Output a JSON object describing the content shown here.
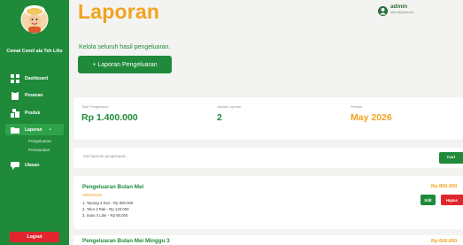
{
  "sidebar": {
    "brand": "Cemal Cemil ala Teh Lilis",
    "items": [
      {
        "label": "Dashboard",
        "icon": "grid-icon"
      },
      {
        "label": "Pesanan",
        "icon": "clipboard-icon"
      },
      {
        "label": "Produk",
        "icon": "products-icon"
      },
      {
        "label": "Laporan",
        "icon": "folder-icon",
        "active": true
      },
      {
        "label": "Ulasan",
        "icon": "chat-icon"
      }
    ],
    "sub_items": [
      "Pengeluaran",
      "Pemasukan"
    ],
    "active_marker": "•",
    "logout_label": "Logout"
  },
  "header": {
    "title": "Laporan",
    "subtitle": "Kelola seluruh hasil pengeluaran.",
    "add_button": "+ Laporan Pengeluaran"
  },
  "user": {
    "name": "admin",
    "email": "admin@gmail.com"
  },
  "stats": [
    {
      "label": "Total Pengeluaran",
      "value": "Rp 1.400.000"
    },
    {
      "label": "Jumlah Laporan",
      "value": "2"
    },
    {
      "label": "Periode",
      "value": "May 2026"
    }
  ],
  "search": {
    "placeholder": "Cari laporan pengeluaran",
    "button": "Cari"
  },
  "reports": [
    {
      "title": "Pengeluaran Bulan Mei",
      "date": "28/05/2026",
      "lines": [
        "1. Tepung 3 Dus - Rp 600.000",
        "2. Telur 3 Rak - Rp 120.000",
        "3. Susu 4 Liter - Rp 80.000"
      ],
      "amount": "Rp 800.000",
      "edit": "Edit",
      "delete": "Hapus"
    },
    {
      "title": "Pengeluaran Bulan Mei Minggu 3",
      "amount": "Rp 600.000"
    }
  ],
  "colors": {
    "primary": "#1f8a3a",
    "accent": "#f1a320",
    "danger": "#e0262d"
  }
}
